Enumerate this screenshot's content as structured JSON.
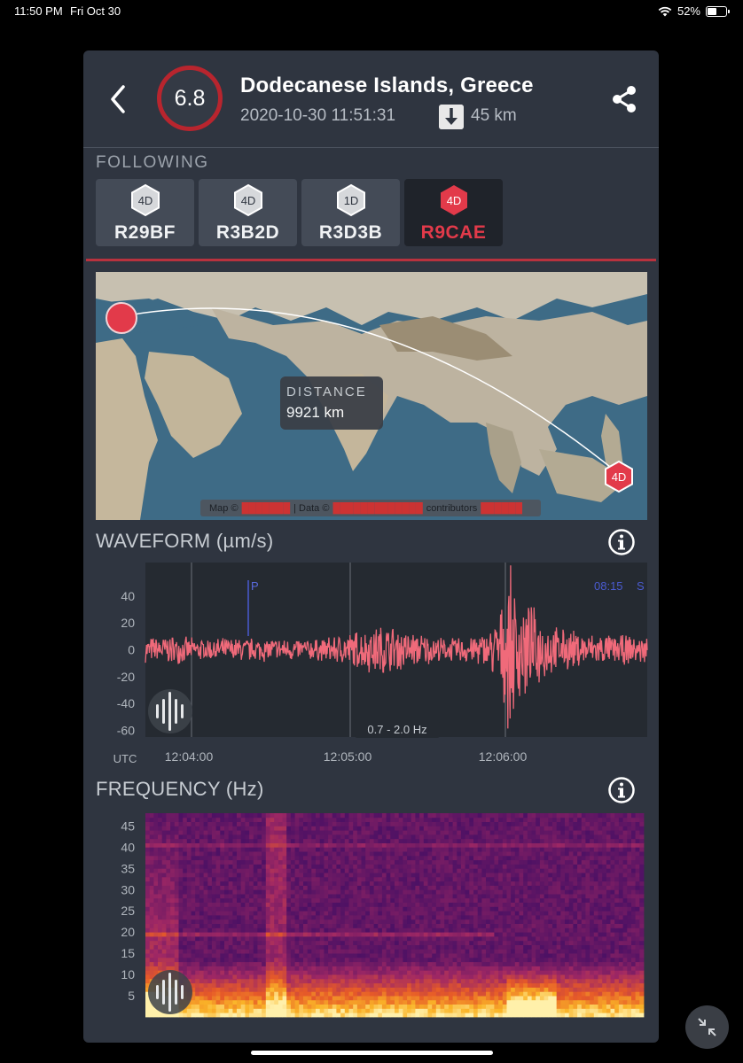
{
  "status": {
    "time": "11:50 PM",
    "date": "Fri Oct 30",
    "battery": "52%"
  },
  "quake": {
    "magnitude": "6.8",
    "place": "Dodecanese Islands, Greece",
    "datetime": "2020-10-30 11:51:31",
    "depth": "45 km"
  },
  "following": {
    "label": "FOLLOWING",
    "stations": [
      {
        "badge": "4D",
        "name": "R29BF",
        "active": false
      },
      {
        "badge": "4D",
        "name": "R3B2D",
        "active": false
      },
      {
        "badge": "1D",
        "name": "R3D3B",
        "active": false
      },
      {
        "badge": "4D",
        "name": "R9CAE",
        "active": true
      }
    ]
  },
  "map": {
    "distance_label": "DISTANCE",
    "distance_value": "9921 km",
    "marker_badge": "4D",
    "attrib_map": "Map ©",
    "attrib_data": "| Data ©",
    "attrib_contrib": "contributors"
  },
  "waveform": {
    "title": "WAVEFORM (µm/s)",
    "p_marker": "P",
    "corner_time": "08:15",
    "corner_s": "S",
    "filter": "0.7 - 2.0 Hz",
    "utc_label": "UTC"
  },
  "frequency": {
    "title": "FREQUENCY (Hz)"
  },
  "colors": {
    "accent": "#e23a4a",
    "panel": "#2f3540",
    "trace": "#f06a7a"
  },
  "chart_data": [
    {
      "type": "line",
      "ylabel": "µm/s",
      "ylim": [
        -65,
        65
      ],
      "yticks": [
        40,
        20,
        0,
        -20,
        -40,
        -60
      ],
      "xticks": [
        "12:04:00",
        "12:05:00",
        "12:06:00"
      ],
      "envelope": [
        {
          "t": 0.0,
          "amp": 10
        },
        {
          "t": 0.05,
          "amp": 12
        },
        {
          "t": 0.1,
          "amp": 9
        },
        {
          "t": 0.2,
          "amp": 10
        },
        {
          "t": 0.35,
          "amp": 9
        },
        {
          "t": 0.48,
          "amp": 22
        },
        {
          "t": 0.51,
          "amp": 17
        },
        {
          "t": 0.6,
          "amp": 9
        },
        {
          "t": 0.68,
          "amp": 14
        },
        {
          "t": 0.71,
          "amp": 35
        },
        {
          "t": 0.725,
          "amp": 66
        },
        {
          "t": 0.745,
          "amp": 45
        },
        {
          "t": 0.77,
          "amp": 35
        },
        {
          "t": 0.82,
          "amp": 18
        },
        {
          "t": 0.9,
          "amp": 13
        },
        {
          "t": 1.0,
          "amp": 11
        }
      ]
    },
    {
      "type": "heatmap",
      "ylabel": "Hz",
      "ylim": [
        0,
        48
      ],
      "yticks": [
        45,
        40,
        35,
        30,
        25,
        20,
        15,
        10,
        5
      ]
    }
  ]
}
